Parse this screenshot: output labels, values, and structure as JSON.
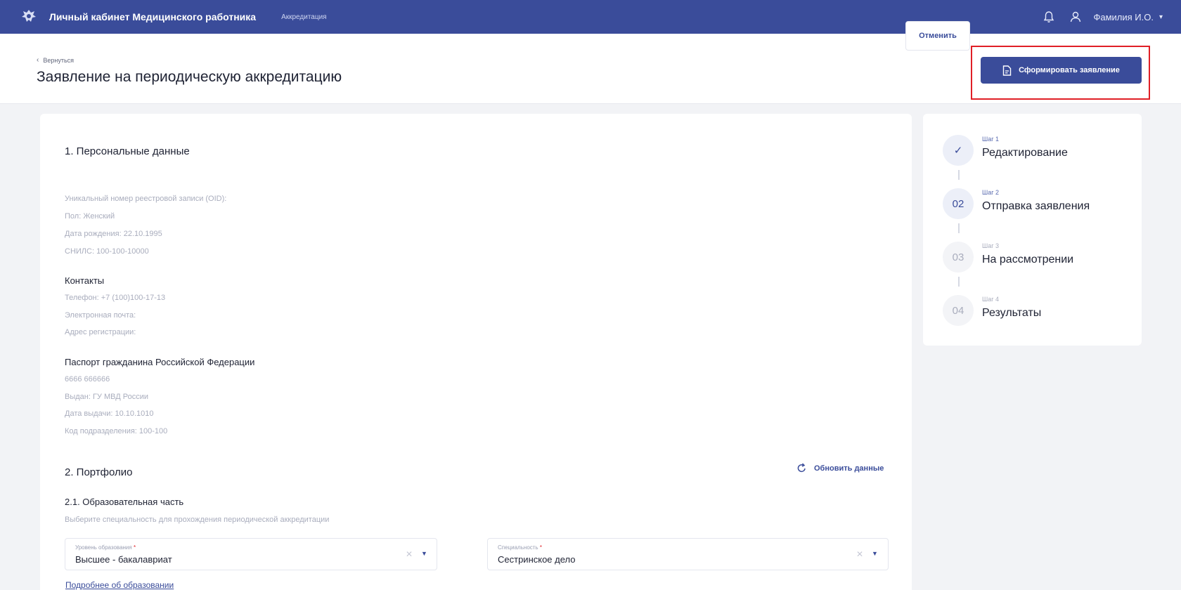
{
  "header": {
    "app_title": "Личный кабинет Медицинского работника",
    "section": "Аккредитация",
    "user_name": "Фамилия И.О.",
    "icons": [
      "emblem-icon",
      "bell-icon",
      "user-icon",
      "chevron-down-icon"
    ]
  },
  "page": {
    "back_label": "Вернуться",
    "title": "Заявление на периодическую аккредитацию",
    "cancel_label": "Отменить",
    "submit_label": "Сформировать заявление",
    "accent_color": "#3a4c9a",
    "highlight_color": "#e01f26"
  },
  "personal": {
    "title": "1. Персональные данные",
    "oid": "Уникальный номер реестровой записи (OID):",
    "gender": "Пол: Женский",
    "birth_date": "Дата рождения: 22.10.1995",
    "snils": "СНИЛС: 100-100-10000"
  },
  "contacts": {
    "title": "Контакты",
    "phone": "Телефон: +7 (100)100-17-13",
    "email": "Электронная почта:",
    "address": "Адрес регистрации:"
  },
  "passport": {
    "title": "Паспорт гражданина Российской Федерации",
    "number": "6666 666666",
    "issued_by": "Выдан: ГУ МВД России",
    "issue_date": "Дата выдачи: 10.10.1010",
    "dept_code": "Код подразделения: 100-100"
  },
  "portfolio": {
    "title": "2. Портфолио",
    "refresh_label": "Обновить данные",
    "edu_title": "2.1. Образовательная часть",
    "hint": "Выберите специальность для прохождения периодической аккредитации",
    "education_level": {
      "label": "Уровень образования",
      "value": "Высшее - бакалавриат"
    },
    "specialty": {
      "label": "Специальность",
      "value": "Сестринское дело"
    },
    "more_link": "Подробнее об образовании"
  },
  "steps": [
    {
      "no": "Шаг 1",
      "name": "Редактирование",
      "marker": "✓",
      "state": "done"
    },
    {
      "no": "Шаг 2",
      "name": "Отправка заявления",
      "marker": "02",
      "state": "active"
    },
    {
      "no": "Шаг 3",
      "name": "На рассмотрении",
      "marker": "03",
      "state": "pending"
    },
    {
      "no": "Шаг 4",
      "name": "Результаты",
      "marker": "04",
      "state": "pending"
    }
  ]
}
